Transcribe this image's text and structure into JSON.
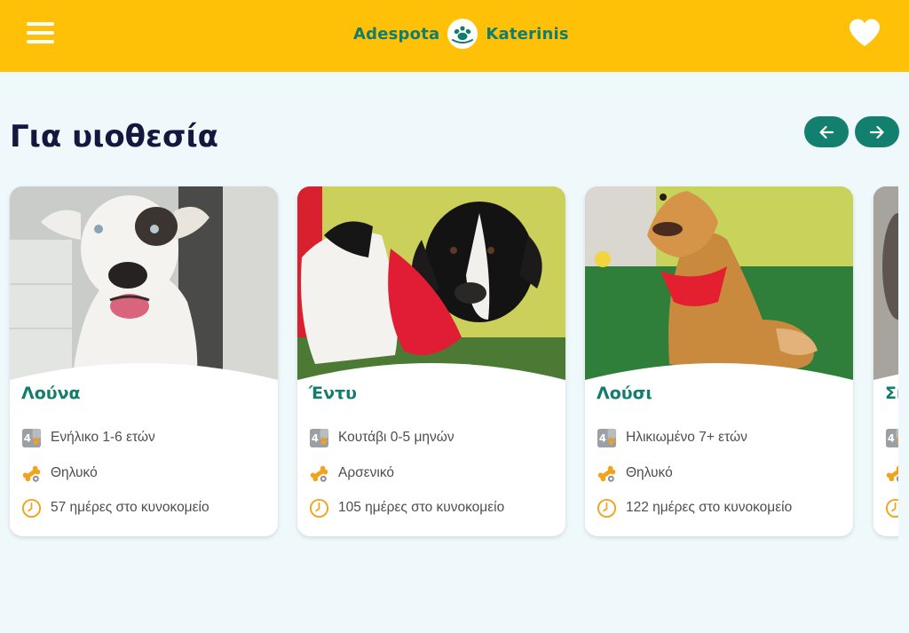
{
  "header": {
    "logo_left": "Adespota",
    "logo_right": "Katerinis",
    "menu_icon": "hamburger-menu-icon",
    "favorites_icon": "heart-icon"
  },
  "section": {
    "title": "Για υιοθεσία",
    "prev_icon": "arrow-left-icon",
    "next_icon": "arrow-right-icon"
  },
  "colors": {
    "header_bg": "#ffc107",
    "brand_green": "#137c6d",
    "title_navy": "#14183f",
    "page_bg": "#eff8fa",
    "button_bg": "#13806f"
  },
  "pets": [
    {
      "name": "Λούνα",
      "age": "Ενήλικο 1-6 ετών",
      "gender": "Θηλυκό",
      "days": "57 ημέρες στο κυνοκομείο"
    },
    {
      "name": "Έντυ",
      "age": "Κουτάβι 0-5 μηνών",
      "gender": "Αρσενικό",
      "days": "105 ημέρες στο κυνοκομείο"
    },
    {
      "name": "Λούσι",
      "age": "Ηλικιωμένο 7+ ετών",
      "gender": "Θηλυκό",
      "days": "122 ημέρες στο κυνοκομείο"
    },
    {
      "name": "Σί"
    }
  ]
}
